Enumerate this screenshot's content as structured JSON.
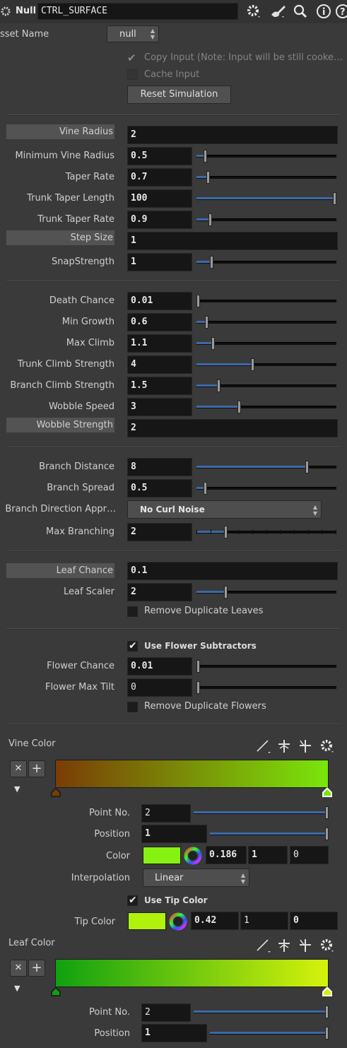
{
  "header": {
    "node_type": "Null",
    "node_name": "CTRL_SURFACE"
  },
  "asset_name": {
    "label": "sset Name",
    "value": "null"
  },
  "copy_input": {
    "label": "Copy Input (Note: Input will be still cooke…",
    "checked": true
  },
  "cache_input": {
    "label": "Cache Input",
    "checked": false
  },
  "reset_simulation": "Reset Simulation",
  "params1": [
    {
      "label": "Vine Radius",
      "value": "2",
      "highlight": true,
      "slider": false
    },
    {
      "label": "Minimum Vine Radius",
      "value": "0.5",
      "fraction": 0.05
    },
    {
      "label": "Taper Rate",
      "value": "0.7",
      "fraction": 0.07
    },
    {
      "label": "Trunk Taper Length",
      "value": "100",
      "fraction": 1.0
    },
    {
      "label": "Trunk Taper Rate",
      "value": "0.9",
      "fraction": 0.09
    },
    {
      "label": "Step Size",
      "value": "1",
      "highlight": true,
      "slider": false
    },
    {
      "label": "SnapStrength",
      "value": "1",
      "fraction": 0.1
    }
  ],
  "params2": [
    {
      "label": "Death Chance",
      "value": "0.01",
      "fraction": 0.0
    },
    {
      "label": "Min Growth",
      "value": "0.6",
      "fraction": 0.06
    },
    {
      "label": "Max Climb",
      "value": "1.1",
      "fraction": 0.11
    },
    {
      "label": "Trunk Climb Strength",
      "value": "4",
      "fraction": 0.4
    },
    {
      "label": "Branch Climb Strength",
      "value": "1.5",
      "fraction": 0.15
    },
    {
      "label": "Wobble Speed",
      "value": "3",
      "fraction": 0.3
    },
    {
      "label": "Wobble Strength",
      "value": "2",
      "highlight": true,
      "slider": false
    }
  ],
  "params3": {
    "branch_distance": {
      "label": "Branch Distance",
      "value": "8",
      "fraction": 0.8
    },
    "branch_spread": {
      "label": "Branch Spread",
      "value": "0.5",
      "fraction": 0.05
    },
    "branch_direction": {
      "label": "Branch Direction Appr…",
      "value": "No Curl Noise"
    },
    "max_branching": {
      "label": "Max Branching",
      "value": "2",
      "fraction": 0.2
    }
  },
  "leaf": {
    "leaf_chance": {
      "label": "Leaf Chance",
      "value": "0.1"
    },
    "leaf_scaler": {
      "label": "Leaf Scaler",
      "value": "2",
      "fraction": 0.2
    },
    "remove_duplicate_leaves": {
      "label": "Remove Duplicate Leaves",
      "checked": false
    }
  },
  "flower": {
    "use_flower_subtractors": {
      "label": "Use Flower Subtractors",
      "checked": true
    },
    "flower_chance": {
      "label": "Flower Chance",
      "value": "0.01",
      "fraction": 0.0
    },
    "flower_max_tilt": {
      "label": "Flower Max Tilt",
      "value": "0",
      "fraction": 0.0
    },
    "remove_duplicate_flowers": {
      "label": "Remove Duplicate Flowers",
      "checked": false
    }
  },
  "vine_color": {
    "title": "Vine Color",
    "ramp_start": "#7a3c06",
    "ramp_end": "#7ae60a",
    "point_no": {
      "label": "Point No.",
      "value": "2",
      "fraction": 1.0
    },
    "position": {
      "label": "Position",
      "value": "1",
      "fraction": 1.0
    },
    "color": {
      "label": "Color",
      "swatch": "#86f211",
      "r": "0.186",
      "g": "1",
      "b": "0"
    },
    "interpolation": {
      "label": "Interpolation",
      "value": "Linear"
    },
    "use_tip_color": {
      "label": "Use Tip Color",
      "checked": true
    },
    "tip_color": {
      "label": "Tip Color",
      "swatch": "#b0f20c",
      "r": "0.42",
      "g": "1",
      "b": "0"
    }
  },
  "leaf_color": {
    "title": "Leaf Color",
    "ramp_start": "#10a010",
    "ramp_end": "#d6f20c",
    "point_no": {
      "label": "Point No.",
      "value": "2",
      "fraction": 1.0
    },
    "position": {
      "label": "Position",
      "value": "1",
      "fraction": 1.0
    }
  },
  "icons": [
    "gear-icon",
    "brush-icon",
    "search-icon",
    "info-icon",
    "help-icon"
  ],
  "colors": {
    "accent": "#3c6aa8",
    "field_bg": "#161616",
    "panel_bg": "#3a3a3a"
  }
}
